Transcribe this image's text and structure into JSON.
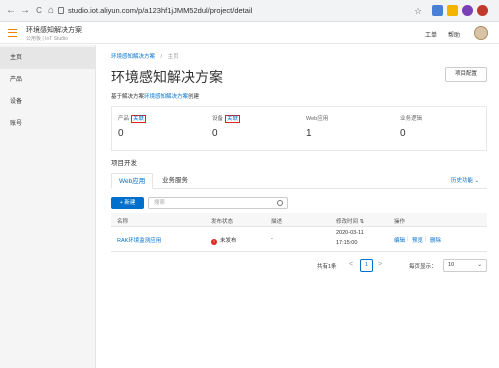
{
  "browser": {
    "url": "studio.iot.aliyun.com/p/a123hf1jJMM52dul/project/detail",
    "nav": {
      "back": "←",
      "forward": "→",
      "reload": "C",
      "home": "⌂"
    },
    "star_icon": "star-icon"
  },
  "header": {
    "title": "环境感知解决方案",
    "subtitle": "公用板 | IoT Studio",
    "links": [
      "工单",
      "帮助"
    ]
  },
  "sidebar": {
    "items": [
      {
        "label": "主页",
        "active": true
      },
      {
        "label": "产品",
        "active": false
      },
      {
        "label": "设备",
        "active": false
      },
      {
        "label": "账号",
        "active": false
      }
    ]
  },
  "breadcrumb": {
    "parent": "环境感知解决方案",
    "sep": "/",
    "current": "主页"
  },
  "page": {
    "title": "环境感知解决方案",
    "config_button": "项目配置",
    "desc_prefix": "基于解决方案",
    "desc_link": "环境感知解决方案",
    "desc_suffix": "创建"
  },
  "stats": [
    {
      "label": "产品",
      "link": "关联",
      "value": "0"
    },
    {
      "label": "设备",
      "link": "关联",
      "value": "0"
    },
    {
      "label": "Web应用",
      "link": "",
      "value": "1"
    },
    {
      "label": "业务逻辑",
      "link": "",
      "value": "0"
    }
  ],
  "dev": {
    "title": "项目开发",
    "tabs": [
      "Web应用",
      "业务服务"
    ],
    "history_link": "历史功能",
    "new_button": "+ 新建",
    "search_placeholder": "搜索"
  },
  "table": {
    "columns": [
      "名称",
      "发布状态",
      "描述",
      "修改时间 ⇅",
      "操作"
    ],
    "rows": [
      {
        "name": "RAK环境监测应用",
        "status": "未发布",
        "desc": "-",
        "time_date": "2020-03-11",
        "time_clock": "17:15:00",
        "actions": [
          "编辑",
          "预览",
          "删除"
        ]
      }
    ]
  },
  "pager": {
    "total": "共有1条",
    "prev": "<",
    "page": "1",
    "next": ">",
    "per_page_label": "每页显示：",
    "per_page_value": "10"
  },
  "colors": {
    "accent": "#0070cc",
    "brand": "#f08300",
    "danger": "#e0241b"
  }
}
